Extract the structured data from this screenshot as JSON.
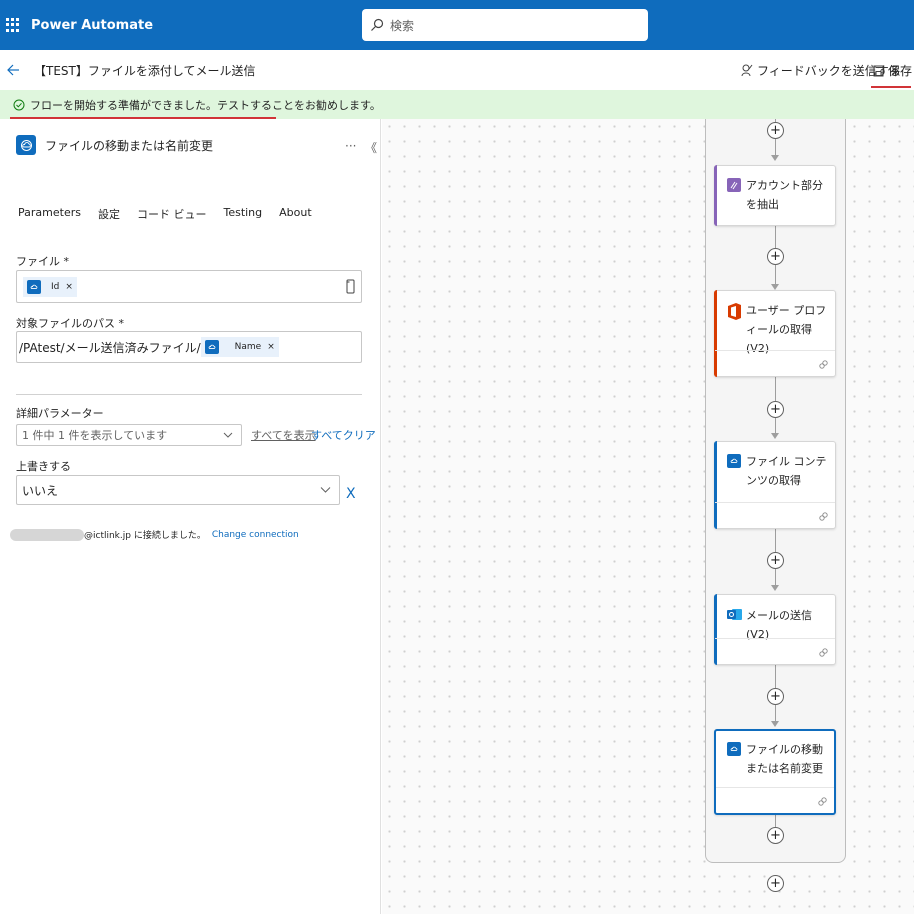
{
  "app": {
    "name": "Power Automate",
    "search_placeholder": "検索"
  },
  "header": {
    "flow_title": "【TEST】ファイルを添付してメール送信",
    "feedback_label": "フィードバックを送信する",
    "save_label": "保存"
  },
  "notice": {
    "text": "フローを開始する準備ができました。テストすることをお勧めします。"
  },
  "panel": {
    "title": "ファイルの移動または名前変更",
    "more_label": "···",
    "collapse_label": "《",
    "tabs": [
      {
        "label": "Parameters",
        "active": true
      },
      {
        "label": "設定"
      },
      {
        "label": "コード ビュー"
      },
      {
        "label": "Testing"
      },
      {
        "label": "About"
      }
    ],
    "file_label": "ファイル *",
    "file_token": "Id",
    "dest_label": "対象ファイルのパス *",
    "dest_prefix": "/PAtest/メール送信済みファイル/",
    "dest_token": "Name",
    "token_remove": "×",
    "advanced_label": "詳細パラメーター",
    "advanced_value": "1 件中 1 件を表示しています",
    "show_all": "すべてを表示",
    "clear_all": "すべてクリア",
    "overwrite_label": "上書きする",
    "overwrite_value": "いいえ",
    "overwrite_clear": "X",
    "connection_text": "@ictlink.jp に接続しました。",
    "change_connection": "Change connection"
  },
  "canvas": {
    "plus": "+",
    "cards": [
      {
        "title": "アカウント部分を抽出",
        "color": "#8764b8",
        "icon": "compose-icon"
      },
      {
        "title": "ユーザー プロフィールの取得 (V2)",
        "color": "#d83b01",
        "icon": "office-icon"
      },
      {
        "title": "ファイル コンテンツの取得",
        "color": "#0f6cbd",
        "icon": "onedrive-icon"
      },
      {
        "title": "メールの送信 (V2)",
        "color": "#0f6cbd",
        "icon": "outlook-icon"
      },
      {
        "title": "ファイルの移動または名前変更",
        "color": "#0f6cbd",
        "icon": "onedrive-icon",
        "selected": true
      }
    ]
  },
  "colors": {
    "brand": "#0f6cbd",
    "notice_bg": "#dff6dd",
    "highlight": "#d13438"
  }
}
